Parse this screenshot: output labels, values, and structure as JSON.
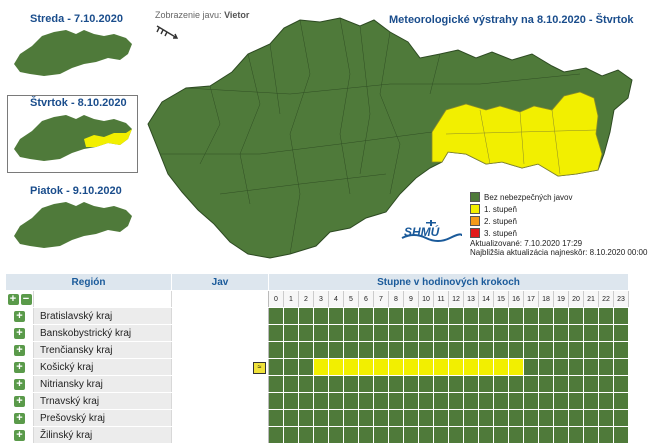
{
  "days": [
    {
      "label": "Streda - 7.10.2020"
    },
    {
      "label": "Štvrtok - 8.10.2020"
    },
    {
      "label": "Piatok - 9.10.2020"
    }
  ],
  "wind": {
    "prefix": "Zobrazenie javu:",
    "value": "Vietor"
  },
  "main_title": "Meteorologické výstrahy na 8.10.2020 - Štvrtok",
  "legend": [
    {
      "label": "Bez nebezpečných javov",
      "color": "#4f7a3a"
    },
    {
      "label": "1. stupeň",
      "color": "#f2ef00"
    },
    {
      "label": "2. stupeň",
      "color": "#f39a1a"
    },
    {
      "label": "3. stupeň",
      "color": "#e21a1a"
    }
  ],
  "logo_text": "SHMÚ",
  "updated": "Aktualizované: 7.10.2020 17:29",
  "next_update": "Najbližšia aktualizácia najneskôr: 8.10.2020 00:00",
  "colors": {
    "green": "#4f7a3a",
    "yellow": "#f2ef00",
    "accent": "#1a4d8c"
  },
  "table": {
    "col_region": "Región",
    "col_jav": "Jav",
    "col_hours": "Stupne v hodinových krokoch",
    "hours": [
      "0",
      "1",
      "2",
      "3",
      "4",
      "5",
      "6",
      "7",
      "8",
      "9",
      "10",
      "11",
      "12",
      "13",
      "14",
      "15",
      "16",
      "17",
      "18",
      "19",
      "20",
      "21",
      "22",
      "23"
    ],
    "rows": [
      {
        "name": "Bratislavský kraj",
        "warn_hours": []
      },
      {
        "name": "Banskobystrický kraj",
        "warn_hours": []
      },
      {
        "name": "Trenčiansky kraj",
        "warn_hours": []
      },
      {
        "name": "Košický kraj",
        "warn_hours": [
          3,
          4,
          5,
          6,
          7,
          8,
          9,
          10,
          11,
          12,
          13,
          14,
          15,
          16
        ],
        "icon": "wind-icon"
      },
      {
        "name": "Nitriansky kraj",
        "warn_hours": []
      },
      {
        "name": "Trnavský kraj",
        "warn_hours": []
      },
      {
        "name": "Prešovský kraj",
        "warn_hours": []
      },
      {
        "name": "Žilinský kraj",
        "warn_hours": []
      }
    ]
  }
}
